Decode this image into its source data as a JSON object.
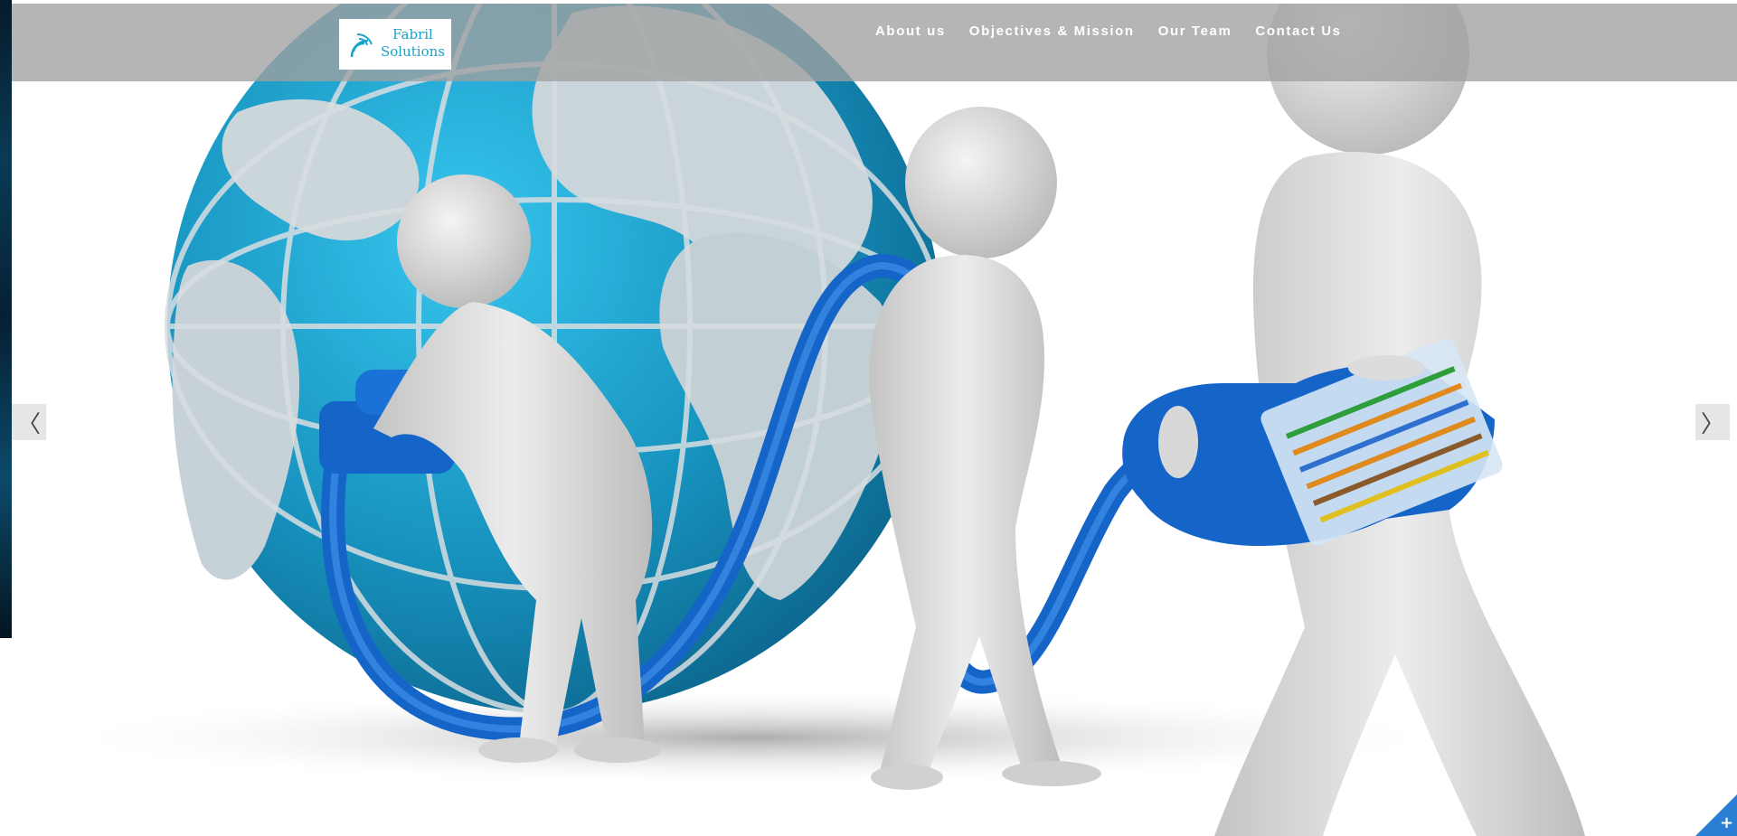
{
  "header": {
    "logo": {
      "line1": "Fabril",
      "line2": "Solutions"
    },
    "nav": [
      {
        "label": "About us"
      },
      {
        "label": "Objectives & Mission"
      },
      {
        "label": "Our Team"
      },
      {
        "label": "Contact Us"
      }
    ]
  },
  "slider": {
    "prev_glyph": "〈",
    "next_glyph": "〉",
    "scroll_glyph": "⌄",
    "corner_glyph": "+",
    "image": "globe-network-cable-people"
  },
  "colors": {
    "header_bg": "#a0a0a0",
    "logo_accent": "#1aa3c8",
    "cable": "#1565c8",
    "globe": "#1a9ac4",
    "corner_accent": "#2a7fd4"
  }
}
